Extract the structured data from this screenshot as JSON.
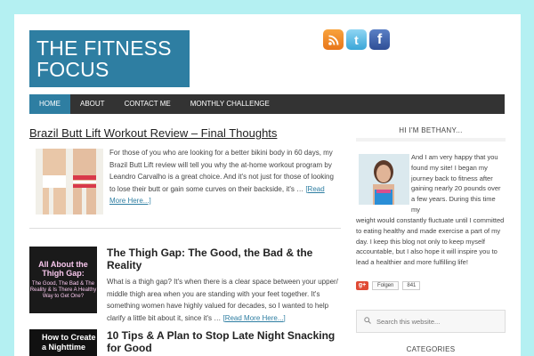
{
  "site": {
    "title_line1": "THE FITNESS",
    "title_line2": "FOCUS"
  },
  "social": {
    "icons": [
      "rss-icon",
      "twitter-icon",
      "facebook-icon"
    ],
    "twitter_glyph": "t",
    "facebook_glyph": "f"
  },
  "nav": {
    "items": [
      "HOME",
      "ABOUT",
      "CONTACT ME",
      "MONTHLY CHALLENGE"
    ],
    "active": "HOME"
  },
  "posts": [
    {
      "title": "Brazil Butt Lift Workout Review – Final Thoughts",
      "excerpt": "For those of you who are looking for a better bikini body in 60 days, my Brazil Butt Lift review will tell you why the at-home workout program by Leandro Carvalho is a great choice. And it's not just for those of looking to lose their butt or gain some curves on their backside, it's …",
      "more": "[Read More Here...]"
    },
    {
      "title": "The Thigh Gap: The Good, the Bad & the Reality",
      "excerpt": "What is a thigh gap? It's when there is a clear space between your upper/ middle thigh area when you are standing with your feet together.  It's something women have highly valued for decades, so I wanted to help clarify a little bit about it, since it's …",
      "more": "[Read More Here...]",
      "thumb_title": "All About the Thigh Gap:",
      "thumb_sub": "The Good, The Bad & The Reality & Is There A Healthy Way to Get One?"
    },
    {
      "title": "10 Tips & A Plan to Stop Late Night Snacking for Good",
      "thumb_title": "How to Create a Nighttime"
    }
  ],
  "sidebar": {
    "about_title": "HI I'M BETHANY...",
    "about_text": "And I am very happy that you found my site! I began my journey back to fitness after gaining nearly 20 pounds over a few years. During this time my weight would constantly fluctuate until I committed to eating healthy and made exercise a part of my day. I keep this blog not only to keep myself accountable, but I also hope it will inspire you to lead a healthier and more fulfilling life!",
    "about_text_top": "And I am very happy that you found my site! I began my journey back to fitness after gaining nearly 20 pounds over a few years. During this time my",
    "about_text_bottom": "weight would constantly fluctuate until I committed to eating healthy and made exercise a part of my day. I keep this blog not only to keep myself accountable, but I also hope it will inspire you to lead a healthier and more fulfilling life!",
    "gplus_label": "g+",
    "gplus_button": "Folgen",
    "gplus_count": "841",
    "search_placeholder": "Search this website...",
    "categories_title": "CATEGORIES"
  }
}
